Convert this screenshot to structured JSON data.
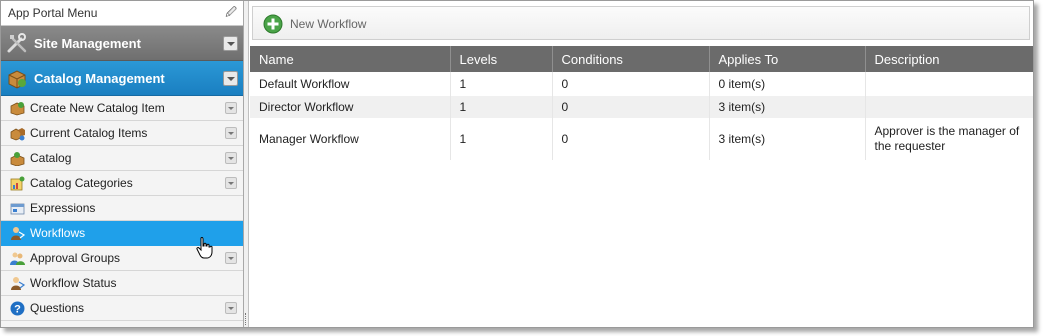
{
  "sidebar": {
    "title": "App Portal Menu",
    "pin_icon": "pin-icon",
    "sections": [
      {
        "label": "Site Management",
        "icon": "tools-icon"
      },
      {
        "label": "Catalog Management",
        "icon": "catalog-box-icon"
      }
    ],
    "items": [
      {
        "label": "Create New Catalog Item",
        "icon": "new-box-icon",
        "expandable": true
      },
      {
        "label": "Current Catalog Items",
        "icon": "boxes-icon",
        "expandable": true
      },
      {
        "label": "Catalog",
        "icon": "catalog-icon",
        "expandable": true
      },
      {
        "label": "Catalog Categories",
        "icon": "categories-icon",
        "expandable": true
      },
      {
        "label": "Expressions",
        "icon": "expression-icon",
        "expandable": false
      },
      {
        "label": "Workflows",
        "icon": "workflow-icon",
        "expandable": false,
        "selected": true
      },
      {
        "label": "Approval Groups",
        "icon": "group-icon",
        "expandable": true
      },
      {
        "label": "Workflow Status",
        "icon": "workflow-status-icon",
        "expandable": false
      },
      {
        "label": "Questions",
        "icon": "question-icon",
        "expandable": true
      }
    ]
  },
  "toolbar": {
    "new_workflow_label": "New Workflow",
    "new_workflow_icon": "plus-icon"
  },
  "grid": {
    "columns": [
      "Name",
      "Levels",
      "Conditions",
      "Applies To",
      "Description"
    ],
    "rows": [
      {
        "name": "Default Workflow",
        "levels": "1",
        "conditions": "0",
        "applies_to": "0 item(s)",
        "description": ""
      },
      {
        "name": "Director Workflow",
        "levels": "1",
        "conditions": "0",
        "applies_to": "3 item(s)",
        "description": ""
      },
      {
        "name": "Manager Workflow",
        "levels": "1",
        "conditions": "0",
        "applies_to": "3 item(s)",
        "description": "Approver is the manager of the requester"
      }
    ]
  },
  "colors": {
    "selected_item": "#1fa0ea",
    "catalog_section": "#1a7fc1",
    "site_section": "#777777",
    "grid_header": "#6b6b6b"
  }
}
